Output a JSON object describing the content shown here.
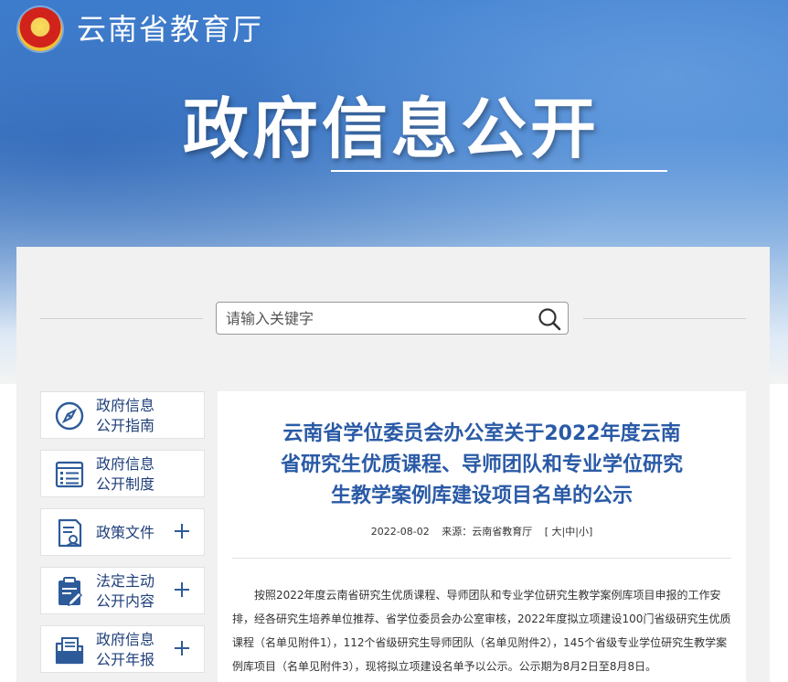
{
  "header": {
    "site_title": "云南省教育厅",
    "hero_title": "政府信息公开",
    "emblem_icon": "national-emblem-icon"
  },
  "search": {
    "placeholder": "请输入关键字",
    "value": "",
    "icon": "search-icon"
  },
  "sidebar": {
    "items": [
      {
        "line1": "政府信息",
        "line2": "公开指南",
        "icon": "compass-icon",
        "expandable": false
      },
      {
        "line1": "政府信息",
        "line2": "公开制度",
        "icon": "list-document-icon",
        "expandable": false
      },
      {
        "line1": "政策文件",
        "line2": "",
        "icon": "policy-document-icon",
        "expandable": true
      },
      {
        "line1": "法定主动",
        "line2": "公开内容",
        "icon": "clipboard-edit-icon",
        "expandable": true
      },
      {
        "line1": "政府信息",
        "line2": "公开年报",
        "icon": "folder-document-icon",
        "expandable": true
      }
    ]
  },
  "article": {
    "title": "云南省学位委员会办公室关于2022年度云南省研究生优质课程、导师团队和专业学位研究生教学案例库建设项目名单的公示",
    "date": "2022-08-02",
    "source": "来源：云南省教育厅",
    "font_size_open": "[",
    "font_size_large": "大",
    "sep1": "|",
    "font_size_medium": "中",
    "sep2": "|",
    "font_size_small": "小",
    "font_size_close": "]",
    "body": "按照2022年度云南省研究生优质课程、导师团队和专业学位研究生教学案例库项目申报的工作安排，经各研究生培养单位推荐、省学位委员会办公室审核，2022年度拟立项建设100门省级研究生优质课程（名单见附件1），112个省级研究生导师团队（名单见附件2），145个省级专业学位研究生教学案例库项目（名单见附件3），现将拟立项建设名单予以公示。公示期为8月2日至8月8日。"
  },
  "colors": {
    "nav_text": "#1f3f7a",
    "title_blue": "#2a5aa6",
    "icon_blue": "#2d5b9a"
  }
}
